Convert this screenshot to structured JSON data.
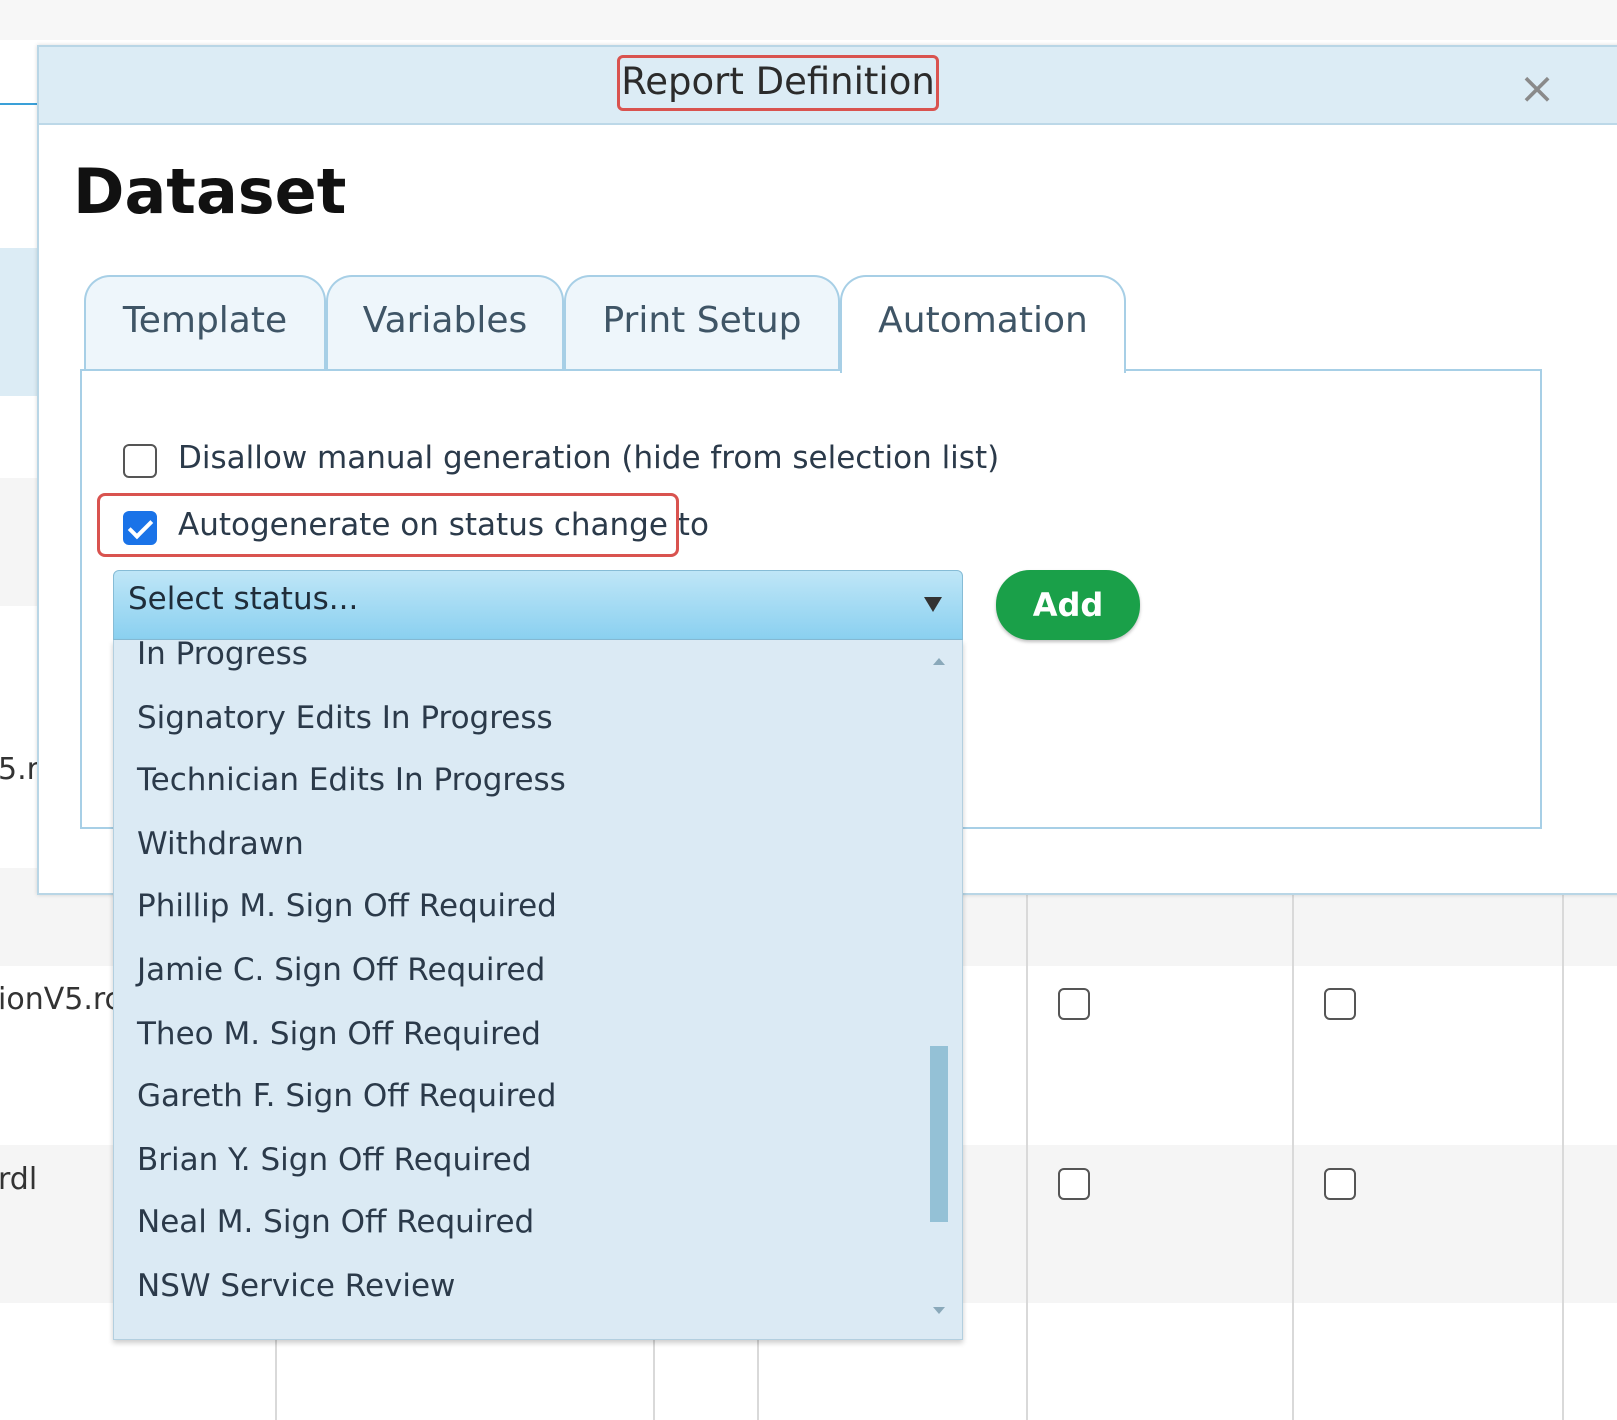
{
  "background": {
    "text_fragments": [
      "5.r",
      "ionV5.rc",
      "rdl"
    ]
  },
  "modal": {
    "title": "Report Definition",
    "close_glyph": "×",
    "heading": "Dataset",
    "tabs": [
      {
        "label": "Template",
        "active": false
      },
      {
        "label": "Variables",
        "active": false
      },
      {
        "label": "Print Setup",
        "active": false
      },
      {
        "label": "Automation",
        "active": true
      }
    ],
    "automation": {
      "disallow_manual": {
        "label": "Disallow manual generation (hide from selection list)",
        "checked": false
      },
      "autogenerate": {
        "label": "Autogenerate on status change to",
        "checked": true
      },
      "status_select": {
        "selected": "Select status...",
        "options": [
          "In Progress",
          "Signatory Edits In Progress",
          "Technician Edits In Progress",
          "Withdrawn",
          "Phillip M. Sign Off Required",
          "Jamie C. Sign Off Required",
          "Theo M. Sign Off Required",
          "Gareth F. Sign Off Required",
          "Brian Y. Sign Off Required",
          "Neal M. Sign Off Required",
          "NSW Service Review"
        ]
      },
      "add_label": "Add"
    }
  },
  "colors": {
    "modal_header": "#dcecf5",
    "tab_border": "#a7cfe6",
    "annotation_red": "#d9534f",
    "checkbox_checked": "#1a73e8",
    "add_button": "#1aa049",
    "dropdown_bg": "#dbeaf4",
    "select_gradient_top": "#bfe6f7",
    "select_gradient_bottom": "#8ad0f0"
  },
  "icons": {
    "close": "close-icon",
    "caret": "caret-down-icon",
    "checked": "checkmark-icon"
  }
}
